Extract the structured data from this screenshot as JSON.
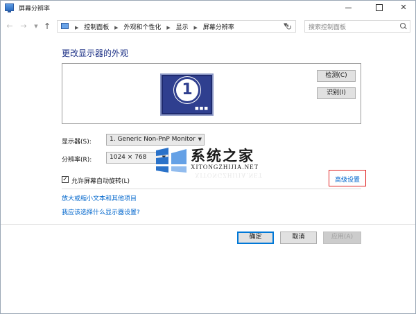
{
  "window": {
    "title": "屏幕分辨率"
  },
  "nav": {
    "breadcrumbs": [
      "控制面板",
      "外观和个性化",
      "显示",
      "屏幕分辨率"
    ],
    "search_placeholder": "搜索控制面板"
  },
  "main": {
    "heading": "更改显示器的外观",
    "monitor_number": "1",
    "detect_label": "检测(C)",
    "identify_label": "识别(I)",
    "display_label": "显示器(S):",
    "display_value": "1. Generic Non-PnP Monitor",
    "resolution_label": "分辨率(R):",
    "resolution_value": "1024 × 768",
    "rotate_checked": true,
    "rotate_label": "允许屏幕自动旋转(L)",
    "advanced_link": "高级设置",
    "link_text_size": "放大或缩小文本和其他项目",
    "link_help": "我应该选择什么显示器设置?"
  },
  "footer": {
    "ok": "确定",
    "cancel": "取消",
    "apply": "应用(A)"
  },
  "watermark": {
    "title": "系统之家",
    "subtitle": "XITONGZHIJIA.NET"
  },
  "colors": {
    "heading": "#1e3287",
    "link": "#0066cc",
    "highlight_box": "#e02222",
    "monitor": "#2f3f8f"
  }
}
